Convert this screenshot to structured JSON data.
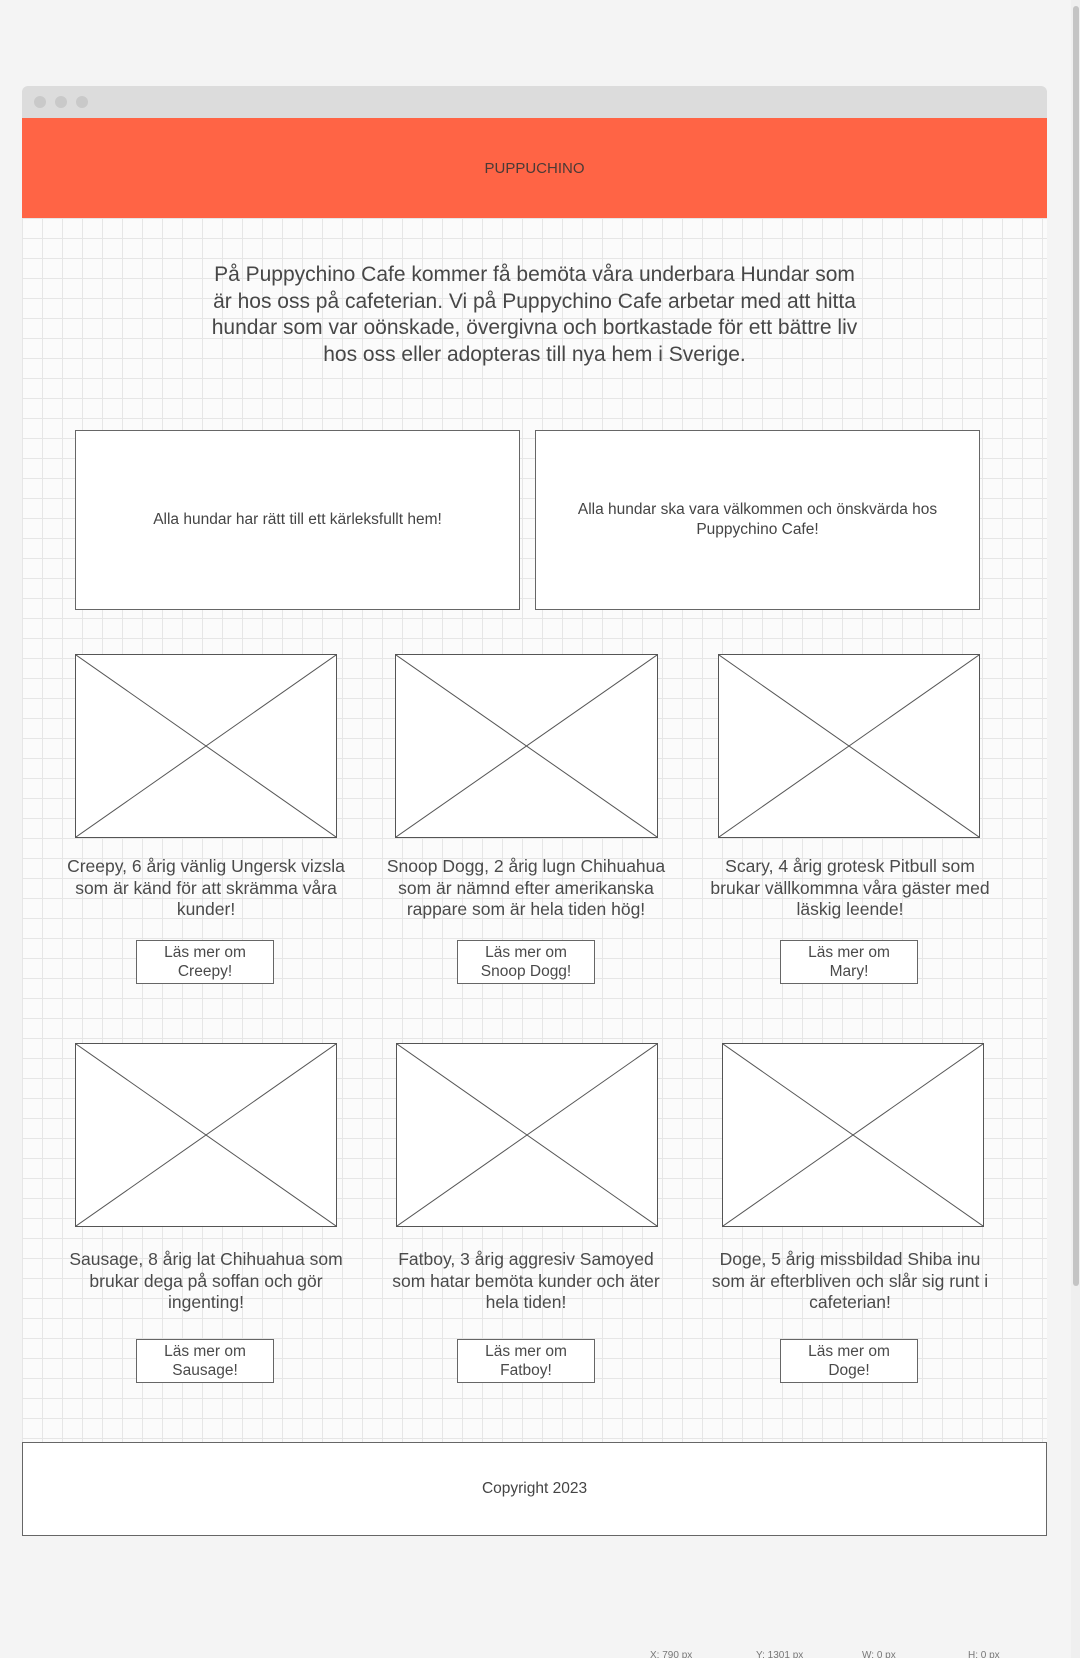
{
  "header": {
    "title": "PUPPUCHINO"
  },
  "intro": "På Puppychino Cafe kommer få bemöta våra underbara Hundar som är hos oss på cafeterian. Vi på Puppychino Cafe arbetar med att hitta hundar som var oönskade, övergivna och bortkastade för ett bättre liv hos oss eller adopteras till nya hem i Sverige.",
  "cards": [
    {
      "text": "Alla hundar har rätt till ett kärleksfullt hem!"
    },
    {
      "text": "Alla hundar ska vara välkommen och önskvärda hos Puppychino Cafe!"
    }
  ],
  "dogs": [
    {
      "description": "Creepy, 6 årig vänlig Ungersk vizsla som är känd för att skrämma våra kunder!",
      "button": "Läs mer om Creepy!"
    },
    {
      "description": "Snoop Dogg, 2 årig lugn Chihuahua som är nämnd efter amerikanska rappare som är hela tiden hög!",
      "button": "Läs mer om Snoop Dogg!"
    },
    {
      "description": "Scary, 4 årig grotesk Pitbull som brukar vällkommna våra gäster med läskig leende!",
      "button": "Läs mer om Mary!"
    },
    {
      "description": "Sausage, 8 årig lat Chihuahua som brukar dega på soffan och gör ingenting!",
      "button": "Läs mer om Sausage!"
    },
    {
      "description": "Fatboy, 3 årig aggresiv Samoyed som hatar bemöta kunder och äter hela tiden!",
      "button": "Läs mer om Fatboy!"
    },
    {
      "description": "Doge, 5 årig missbildad Shiba inu som är efterbliven och slår sig runt i cafeterian!",
      "button": "Läs mer om Doge!"
    }
  ],
  "footer": {
    "text": "Copyright 2023"
  },
  "statusbar": {
    "x": "X: 790 px",
    "y": "Y: 1301 px",
    "w": "W: 0 px",
    "h": "H: 0 px"
  },
  "colors": {
    "header_bg": "#ff6445",
    "page_bg": "#f4f4f4",
    "grid_line": "#e6e6e6"
  }
}
